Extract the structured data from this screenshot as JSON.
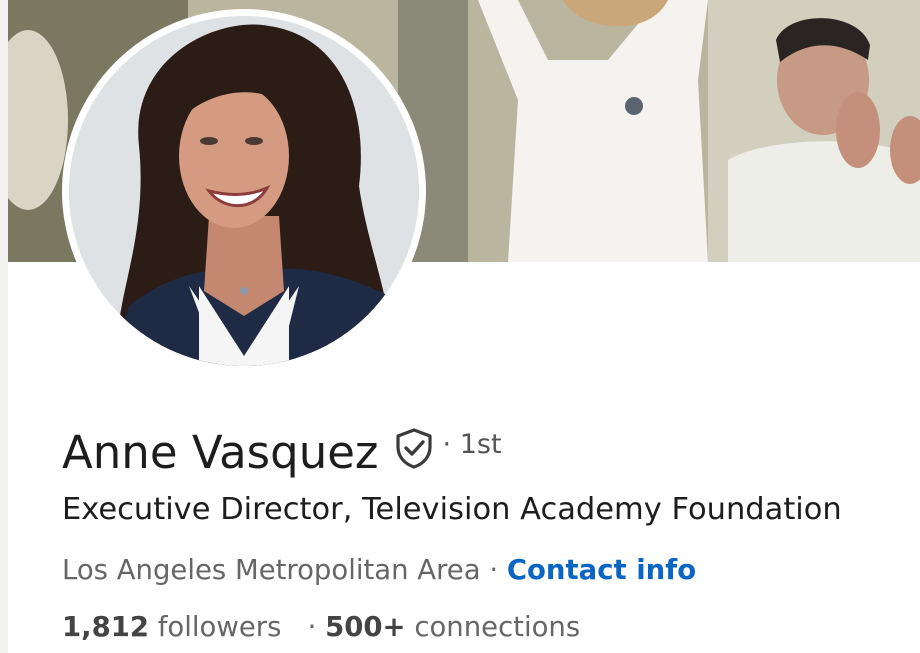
{
  "profile": {
    "name": "Anne Vasquez",
    "verified_icon": "verified-shield-icon",
    "degree": "· 1st",
    "headline": "Executive Director, Television Academy Foundation",
    "location": "Los Angeles Metropolitan Area",
    "separator": "·",
    "contact_info_label": "Contact info",
    "followers_count": "1,812",
    "followers_label": "followers",
    "stats_separator": "·",
    "connections_count": "500+",
    "connections_label": "connections"
  },
  "colors": {
    "link": "#0a66c2",
    "text_primary": "#1d1d1d",
    "text_secondary": "#666666"
  }
}
